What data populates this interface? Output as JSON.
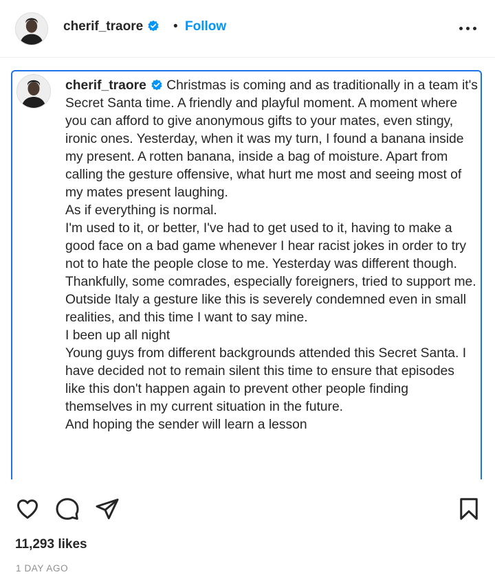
{
  "header": {
    "username": "cherif_traore",
    "separator": "•",
    "follow_label": "Follow"
  },
  "caption": {
    "username": "cherif_traore",
    "text": "Christmas is coming and as traditionally in a team it's Secret Santa time. A friendly and playful moment. A moment where you can afford to give anonymous gifts to your mates, even stingy, ironic ones. Yesterday, when it was my turn, I found a banana inside my present. A rotten banana, inside a bag of moisture. Apart from calling the gesture offensive, what hurt me most and seeing most of my mates present laughing.\nAs if everything is normal.\nI'm used to it, or better, I've had to get used to it, having to make a good face on a bad game whenever I hear racist jokes in order to try not to hate the people close to me. Yesterday was different though. Thankfully, some comrades, especially foreigners, tried to support me. Outside Italy a gesture like this is severely condemned even in small realities, and this time I want to say mine.\nI been up all night\nYoung guys from different backgrounds attended this Secret Santa. I have decided not to remain silent this time to ensure that episodes like this don't happen again to prevent other people finding themselves in my current situation in the future.\nAnd hoping the sender will learn a lesson"
  },
  "icons": {
    "like": "heart-icon",
    "comment": "comment-bubble-icon",
    "share": "paper-plane-icon",
    "save": "bookmark-icon",
    "more": "more-options-icon",
    "verified": "verified-badge-icon"
  },
  "stats": {
    "likes": "11,293 likes",
    "time": "1 DAY AGO"
  },
  "colors": {
    "accent": "#0095f6",
    "selection": "#1a73e8",
    "text": "#262626",
    "muted": "#8e8e8e"
  }
}
